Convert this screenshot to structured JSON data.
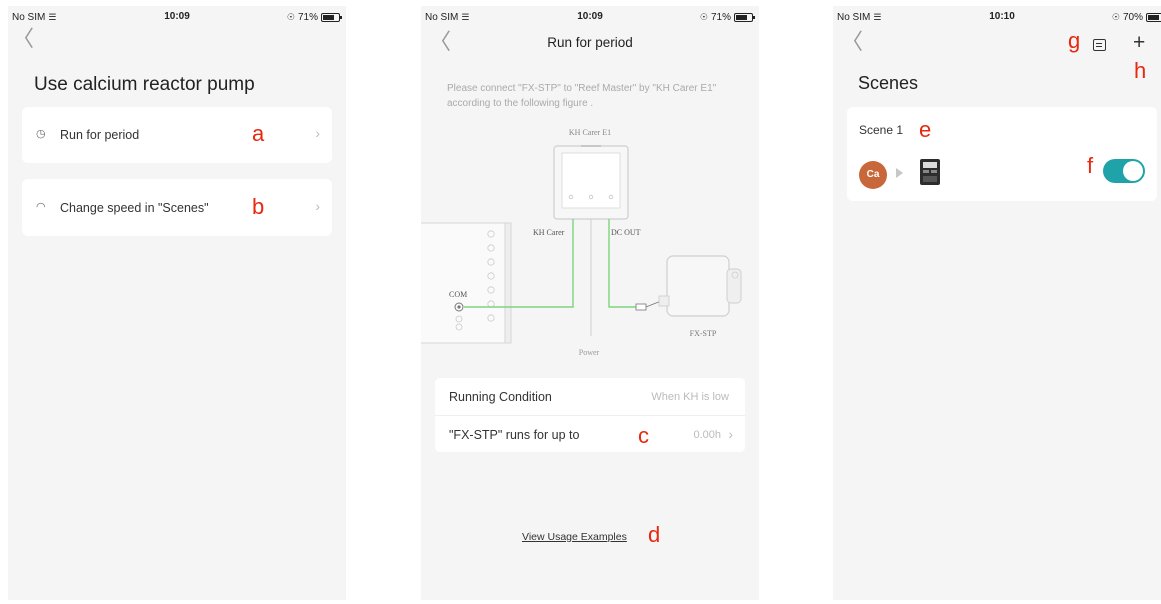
{
  "phone1": {
    "status": {
      "carrier": "No SIM",
      "time": "10:09",
      "battery": "71%",
      "battery_level": 0.71
    },
    "title": "Use calcium reactor pump",
    "items": [
      {
        "label": "Run for period",
        "annotation": "a",
        "icon": "clock-icon"
      },
      {
        "label": "Change speed in \"Scenes\"",
        "annotation": "b",
        "icon": "gauge-icon"
      }
    ]
  },
  "phone2": {
    "status": {
      "carrier": "No SIM",
      "time": "10:09",
      "battery": "71%",
      "battery_level": 0.71
    },
    "title": "Run for period",
    "instruction": "Please connect \"FX-STP\" to \"Reef Master\" by \"KH Carer E1\" according to the following figure .",
    "diagram": {
      "device_top": "KH Carer E1",
      "port_left": "KH Carer",
      "port_right": "DC OUT",
      "com_label": "COM",
      "power_label": "Power",
      "pump_label": "FX-STP"
    },
    "rows": [
      {
        "label": "Running Condition",
        "value": "When KH is low"
      },
      {
        "label": "\"FX-STP\" runs for up to",
        "value": "0.00h",
        "annotation": "c"
      }
    ],
    "link": "View Usage Examples",
    "link_annotation": "d"
  },
  "phone3": {
    "status": {
      "carrier": "No SIM",
      "time": "10:10",
      "battery": "70%",
      "battery_level": 0.7
    },
    "title": "Scenes",
    "scene_name": "Scene 1",
    "scene_annotation": "e",
    "avatar_text": "Ca",
    "toggle_annotation": "f",
    "toggle_on": true,
    "list_annotation": "g",
    "add_annotation": "h"
  },
  "colors": {
    "accent": "#1fa3a8",
    "annotation": "#e8280f",
    "avatar": "#c8673a",
    "wire": "#6fcf6f"
  }
}
